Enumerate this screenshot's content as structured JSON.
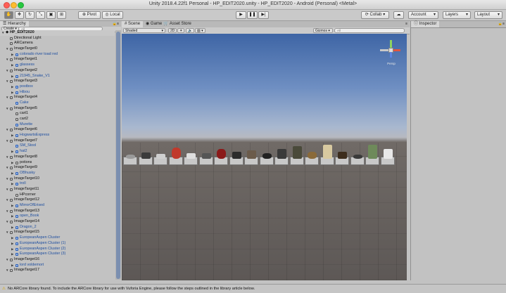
{
  "window": {
    "title": "Unity 2018.4.22f1 Personal - HP_EDIT2020.unity - HP_EDIT2020 - Android (Personal) <Metal>"
  },
  "toolbar": {
    "pivot_label": "Pivot",
    "local_label": "Local",
    "collab_label": "Collab",
    "account_label": "Account",
    "layers_label": "Layers",
    "layout_label": "Layout"
  },
  "hierarchy": {
    "tab_label": "Hierarchy",
    "create_label": "Create",
    "search_placeholder": "All",
    "scene_name": "HP_EDIT2020",
    "items": [
      {
        "indent": 1,
        "label": "Directional Light",
        "arrow": false,
        "prefab": false
      },
      {
        "indent": 1,
        "label": "ARCamera",
        "arrow": false,
        "prefab": false
      },
      {
        "indent": 1,
        "label": "ImageTarget0",
        "arrow": true,
        "prefab": false
      },
      {
        "indent": 2,
        "label": "colorado river toad red",
        "arrow": true,
        "prefab": true
      },
      {
        "indent": 1,
        "label": "ImageTarget1",
        "arrow": true,
        "prefab": false
      },
      {
        "indent": 2,
        "label": "glassess",
        "arrow": true,
        "prefab": true
      },
      {
        "indent": 1,
        "label": "ImageTarget2",
        "arrow": true,
        "prefab": false
      },
      {
        "indent": 2,
        "label": "21945_Snake_V1",
        "arrow": true,
        "prefab": true
      },
      {
        "indent": 1,
        "label": "ImageTarget3",
        "arrow": true,
        "prefab": false
      },
      {
        "indent": 2,
        "label": "postbox",
        "arrow": true,
        "prefab": true
      },
      {
        "indent": 2,
        "label": "Hibou",
        "arrow": true,
        "prefab": true
      },
      {
        "indent": 1,
        "label": "ImageTarget4",
        "arrow": true,
        "prefab": false
      },
      {
        "indent": 2,
        "label": "Cake",
        "arrow": false,
        "prefab": true
      },
      {
        "indent": 1,
        "label": "ImageTarget5",
        "arrow": true,
        "prefab": false
      },
      {
        "indent": 2,
        "label": "cart1",
        "arrow": false,
        "prefab": false
      },
      {
        "indent": 2,
        "label": "cart2",
        "arrow": false,
        "prefab": false
      },
      {
        "indent": 2,
        "label": "Murette",
        "arrow": false,
        "prefab": true
      },
      {
        "indent": 1,
        "label": "ImageTarget6",
        "arrow": true,
        "prefab": false
      },
      {
        "indent": 2,
        "label": "HogwartsExpress",
        "arrow": true,
        "prefab": true
      },
      {
        "indent": 1,
        "label": "ImageTarget7",
        "arrow": true,
        "prefab": false
      },
      {
        "indent": 2,
        "label": "SM_Stool",
        "arrow": false,
        "prefab": true
      },
      {
        "indent": 2,
        "label": "hat2",
        "arrow": true,
        "prefab": true
      },
      {
        "indent": 1,
        "label": "ImageTarget8",
        "arrow": true,
        "prefab": false
      },
      {
        "indent": 2,
        "label": "potions",
        "arrow": true,
        "prefab": false
      },
      {
        "indent": 1,
        "label": "ImageTarget9",
        "arrow": true,
        "prefab": false
      },
      {
        "indent": 2,
        "label": "OBhusky",
        "arrow": true,
        "prefab": true
      },
      {
        "indent": 1,
        "label": "ImageTarget10",
        "arrow": true,
        "prefab": false
      },
      {
        "indent": 2,
        "label": "troll",
        "arrow": true,
        "prefab": true
      },
      {
        "indent": 1,
        "label": "ImageTarget11",
        "arrow": true,
        "prefab": false
      },
      {
        "indent": 2,
        "label": "HPcorner",
        "arrow": false,
        "prefab": false
      },
      {
        "indent": 1,
        "label": "ImageTarget12",
        "arrow": true,
        "prefab": false
      },
      {
        "indent": 2,
        "label": "MirrorOfErised",
        "arrow": true,
        "prefab": true
      },
      {
        "indent": 1,
        "label": "ImageTarget13",
        "arrow": true,
        "prefab": false
      },
      {
        "indent": 2,
        "label": "open_Book",
        "arrow": true,
        "prefab": true
      },
      {
        "indent": 1,
        "label": "ImageTarget14",
        "arrow": true,
        "prefab": false
      },
      {
        "indent": 2,
        "label": "Dragon_2",
        "arrow": true,
        "prefab": true
      },
      {
        "indent": 1,
        "label": "ImageTarget15",
        "arrow": true,
        "prefab": false
      },
      {
        "indent": 2,
        "label": "EuropeanAspen Cluster",
        "arrow": true,
        "prefab": true
      },
      {
        "indent": 2,
        "label": "EuropeanAspen Cluster (1)",
        "arrow": true,
        "prefab": true
      },
      {
        "indent": 2,
        "label": "EuropeanAspen Cluster (2)",
        "arrow": true,
        "prefab": true
      },
      {
        "indent": 2,
        "label": "EuropeanAspen Cluster (3)",
        "arrow": true,
        "prefab": true
      },
      {
        "indent": 1,
        "label": "ImageTarget16",
        "arrow": true,
        "prefab": false
      },
      {
        "indent": 2,
        "label": "lord voldemort",
        "arrow": true,
        "prefab": true
      },
      {
        "indent": 1,
        "label": "ImageTarget17",
        "arrow": true,
        "prefab": false
      }
    ]
  },
  "scene": {
    "tabs": [
      {
        "label": "Scene",
        "active": true
      },
      {
        "label": "Game",
        "active": false
      },
      {
        "label": "Asset Store",
        "active": false
      }
    ],
    "shading_mode": "Shaded",
    "mode_2d_label": "2D",
    "gizmos_label": "Gizmos",
    "search_placeholder": "All",
    "view_label": "Persp",
    "object_count": 18
  },
  "inspector": {
    "tab_label": "Inspector"
  },
  "status": {
    "message": "No ARCore library found. To include the ARCore library for use with Vuforia Engine, please follow the steps outlined in the library article below."
  },
  "colors": {
    "sky_top": "#3e65a5",
    "ground": "#5d5856",
    "prefab_text": "#1f4fa0",
    "close_light": "#ff5f57",
    "min_light": "#febc2e",
    "max_light": "#28c840"
  }
}
